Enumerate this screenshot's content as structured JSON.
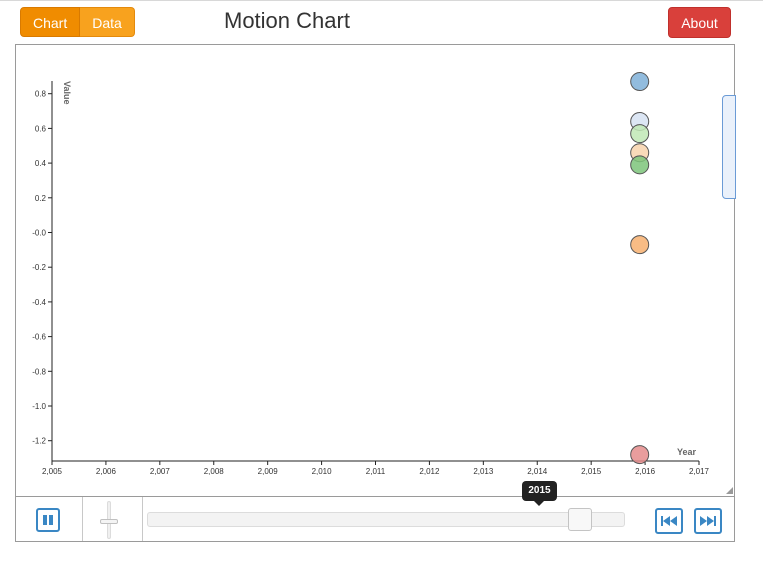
{
  "header": {
    "tabs": [
      {
        "label": "Chart",
        "active": true
      },
      {
        "label": "Data",
        "active": false
      }
    ],
    "title": "Motion Chart",
    "about_label": "About"
  },
  "colors": {
    "accent_orange": "#f8a21e",
    "about_red": "#d9403b",
    "control_blue": "#3a87c4"
  },
  "chart_data": {
    "type": "scatter",
    "xlabel": "Year",
    "ylabel": "Value",
    "xlim": [
      2005,
      2017
    ],
    "ylim": [
      -1.3,
      0.9
    ],
    "x_ticks": [
      "2,005",
      "2,006",
      "2,007",
      "2,008",
      "2,009",
      "2,010",
      "2,011",
      "2,012",
      "2,013",
      "2,014",
      "2,015",
      "2,016",
      "2,017"
    ],
    "y_ticks": [
      "0.8",
      "0.6",
      "0.4",
      "0.2",
      "-0.0",
      "-0.2",
      "-0.4",
      "-0.6",
      "-0.8",
      "-1.0",
      "-1.2"
    ],
    "points": [
      {
        "x": 2015.9,
        "y": 0.87,
        "color": "#7fb0d8"
      },
      {
        "x": 2015.9,
        "y": 0.64,
        "color": "#d6e2f2"
      },
      {
        "x": 2015.9,
        "y": 0.57,
        "color": "#bfe8b5"
      },
      {
        "x": 2015.9,
        "y": 0.46,
        "color": "#f8d3ad"
      },
      {
        "x": 2015.9,
        "y": 0.39,
        "color": "#7cc47a"
      },
      {
        "x": 2015.9,
        "y": -0.07,
        "color": "#f7b070"
      },
      {
        "x": 2015.9,
        "y": -1.28,
        "color": "#e58c8c"
      }
    ]
  },
  "controls": {
    "current_year": "2015",
    "year_range": [
      2005,
      2016
    ],
    "play_state": "pause",
    "prev_label": "previous",
    "next_label": "next"
  }
}
